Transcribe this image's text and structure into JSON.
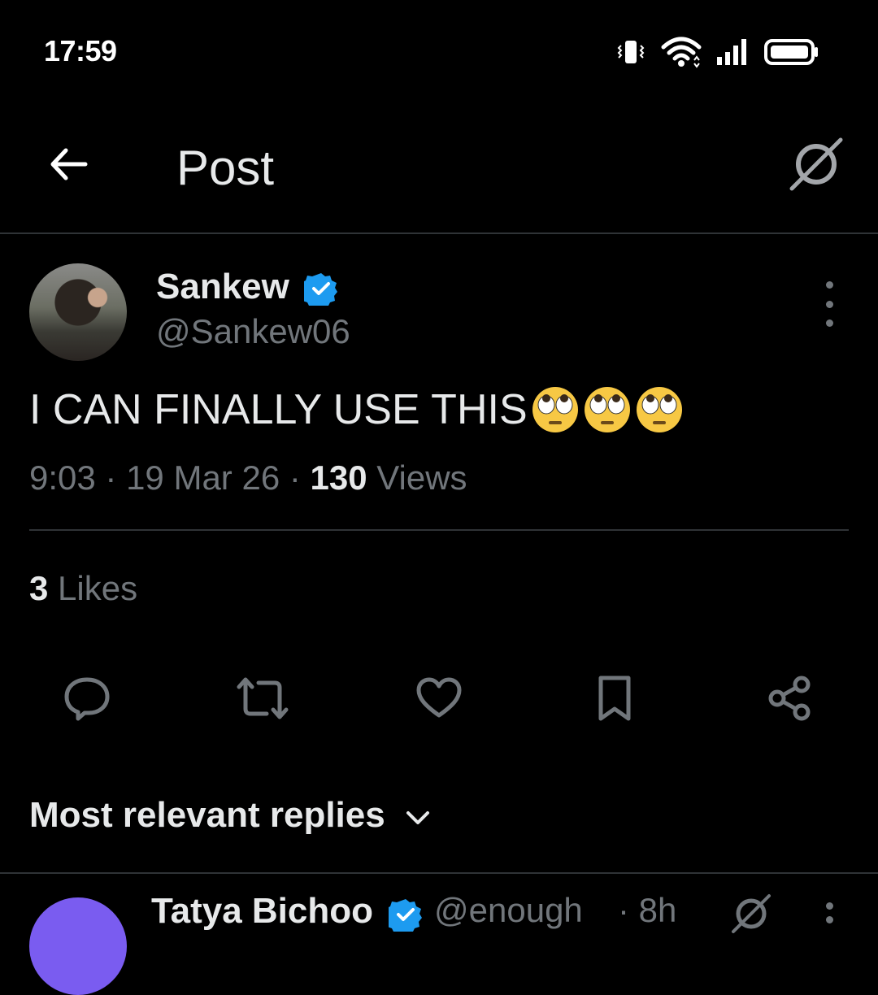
{
  "status_bar": {
    "time": "17:59",
    "icons": [
      "vibrate-icon",
      "wifi-icon",
      "signal-icon",
      "battery-icon"
    ]
  },
  "header": {
    "title": "Post",
    "back_icon": "arrow-left-icon",
    "grok_icon": "grok-icon"
  },
  "post": {
    "author_name": "Sankew",
    "author_handle": "@Sankew06",
    "verified": true,
    "text": "I CAN FINALLY USE THIS",
    "emojis": [
      "face-with-rolling-eyes",
      "face-with-rolling-eyes",
      "face-with-rolling-eyes"
    ],
    "time": "9:03",
    "date": "19 Mar 26",
    "views_count": "130",
    "views_label": "Views",
    "likes_count": "3",
    "likes_label": "Likes"
  },
  "actions": [
    {
      "name": "reply",
      "icon": "reply-icon"
    },
    {
      "name": "repost",
      "icon": "repost-icon"
    },
    {
      "name": "like",
      "icon": "heart-icon"
    },
    {
      "name": "bookmark",
      "icon": "bookmark-icon"
    },
    {
      "name": "share",
      "icon": "share-icon"
    }
  ],
  "replies": {
    "sort_label": "Most relevant replies",
    "first_reply": {
      "name": "Tatya Bichoo",
      "handle": "@enough",
      "time": "· 8h"
    }
  },
  "colors": {
    "background": "#000000",
    "text_primary": "#e7e9ea",
    "text_secondary": "#71767b",
    "divider": "#2f3336",
    "verified_blue": "#1d9bf0"
  }
}
